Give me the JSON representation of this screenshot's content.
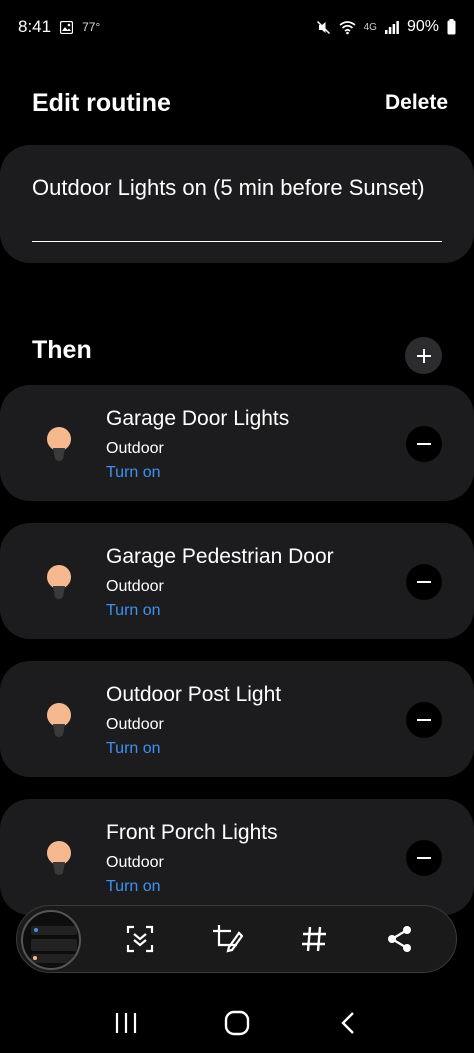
{
  "status": {
    "time": "8:41",
    "temperature": "77°",
    "network": "4G",
    "battery": "90%"
  },
  "header": {
    "title": "Edit routine",
    "delete_label": "Delete"
  },
  "routine": {
    "name": "Outdoor Lights on (5 min before Sunset)"
  },
  "then_section": {
    "label": "Then",
    "add_icon": "plus-icon"
  },
  "devices": [
    {
      "name": "Garage Door Lights",
      "room": "Outdoor",
      "action": "Turn on",
      "icon": "light-bulb-icon"
    },
    {
      "name": "Garage Pedestrian Door",
      "room": "Outdoor",
      "action": "Turn on",
      "icon": "light-bulb-icon"
    },
    {
      "name": "Outdoor Post Light",
      "room": "Outdoor",
      "action": "Turn on",
      "icon": "light-bulb-icon"
    },
    {
      "name": "Front Porch Lights",
      "room": "Outdoor",
      "action": "Turn on",
      "icon": "light-bulb-icon"
    }
  ],
  "screenshot_toolbar": {
    "icons": [
      "scroll-capture-icon",
      "crop-edit-icon",
      "hashtag-icon",
      "share-icon"
    ]
  },
  "navigation": {
    "icons": [
      "recent-apps-icon",
      "home-icon",
      "back-icon"
    ]
  },
  "colors": {
    "background": "#000000",
    "card": "#1c1c1e",
    "accent_link": "#3e91f2",
    "bulb_glow": "#f6b98f"
  }
}
